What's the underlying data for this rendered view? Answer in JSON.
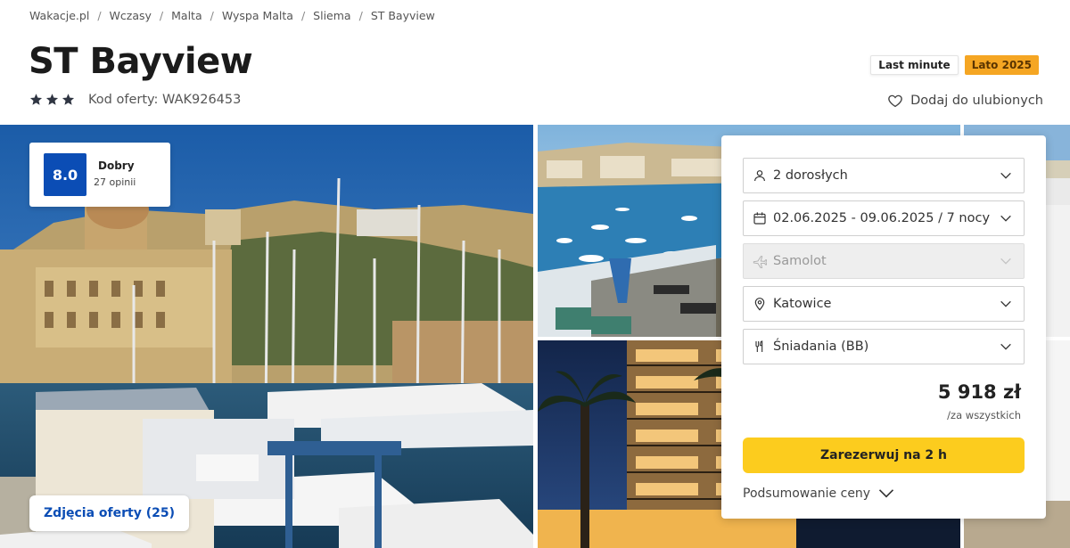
{
  "breadcrumb": [
    "Wakacje.pl",
    "Wczasy",
    "Malta",
    "Wyspa Malta",
    "Sliema",
    "ST Bayview"
  ],
  "breadcrumb_separator": "/",
  "hotel": {
    "name": "ST Bayview",
    "stars": 3,
    "offer_code": "Kod oferty: WAK926453"
  },
  "badges": {
    "last_minute": "Last minute",
    "season": "Lato 2025"
  },
  "favorite_label": "Dodaj do ulubionych",
  "rating": {
    "score": "8.0",
    "label": "Dobry",
    "count": "27 opinii"
  },
  "photos_button": "Zdjęcia oferty (25)",
  "booking": {
    "guests": "2 dorosłych",
    "dates": "02.06.2025 - 09.06.2025 / 7 nocy",
    "transport": "Samolot",
    "departure": "Katowice",
    "board": "Śniadania (BB)",
    "price": "5 918 zł",
    "price_note": "/za wszystkich",
    "book_button": "Zarezerwuj na 2 h",
    "summary_label": "Podsumowanie ceny"
  },
  "colors": {
    "brand_blue": "#0b4db5",
    "book_yellow": "#fccc1e",
    "season_orange": "#f5a623"
  }
}
